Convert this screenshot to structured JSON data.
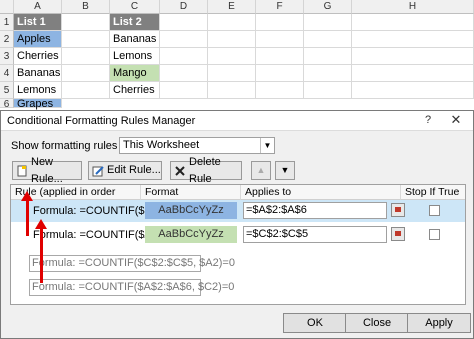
{
  "spreadsheet": {
    "columns": [
      "A",
      "B",
      "C",
      "D",
      "E",
      "F",
      "G",
      "H"
    ],
    "rows": [
      "1",
      "2",
      "3",
      "4",
      "5",
      "6"
    ],
    "list1": [
      "List 1",
      "Apples",
      "Cherries",
      "Bananas",
      "Lemons",
      "Grapes"
    ],
    "list2": [
      "List 2",
      "Bananas",
      "Lemons",
      "Mango",
      "Cherries"
    ]
  },
  "dialog": {
    "title": "Conditional Formatting Rules Manager",
    "help": "?",
    "close": "✕",
    "show_label": "Show formatting rules for:",
    "show_value": "This Worksheet",
    "toolbar": {
      "new_rule": "New Rule...",
      "edit_rule": "Edit Rule...",
      "delete_rule": "Delete Rule"
    },
    "table_headers": {
      "rule": "Rule (applied in order shown)",
      "format": "Format",
      "applies_to": "Applies to",
      "stop_if_true": "Stop If True"
    },
    "rules": [
      {
        "label": "Formula: =COUNTIF($C$...",
        "format_preview": "AaBbCcYyZz",
        "applies_to": "=$A$2:$A$6",
        "color": "#8db4e2"
      },
      {
        "label": "Formula: =COUNTIF($A$...",
        "format_preview": "AaBbCcYyZz",
        "applies_to": "=$C$2:$C$5",
        "color": "#c4e0b2"
      }
    ],
    "ghost_formulas": [
      "Formula: =COUNTIF($C$2:$C$5, $A2)=0",
      "Formula: =COUNTIF($A$2:$A$6, $C2)=0"
    ],
    "buttons": {
      "ok": "OK",
      "close": "Close",
      "apply": "Apply"
    }
  }
}
